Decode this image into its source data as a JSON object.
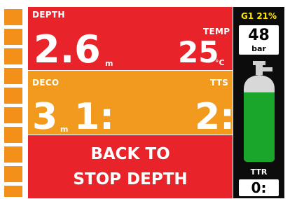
{
  "depth": {
    "label": "DEPTH",
    "value": "2.6",
    "unit": "m"
  },
  "temp": {
    "label": "TEMP",
    "value": "25",
    "unit": "°C"
  },
  "deco": {
    "label": "DECO",
    "stop": "3",
    "stop_unit": "m",
    "time": "1:"
  },
  "tts": {
    "label": "TTS",
    "value": "2:"
  },
  "message": {
    "line1": "BACK TO",
    "line2": "STOP DEPTH"
  },
  "gas": {
    "name": "G1 21%",
    "pressure": "48",
    "pressure_unit": "bar",
    "fill_level": 0.8,
    "ttr_label": "TTR",
    "ttr_value": "0:"
  },
  "ascent_bar": {
    "segments": 11,
    "color": "#f29019"
  },
  "colors": {
    "depth_bg": "#e8232a",
    "deco_bg": "#f29a1d",
    "gas_name": "#ffe600",
    "cylinder_gas": "#1aa62a"
  }
}
